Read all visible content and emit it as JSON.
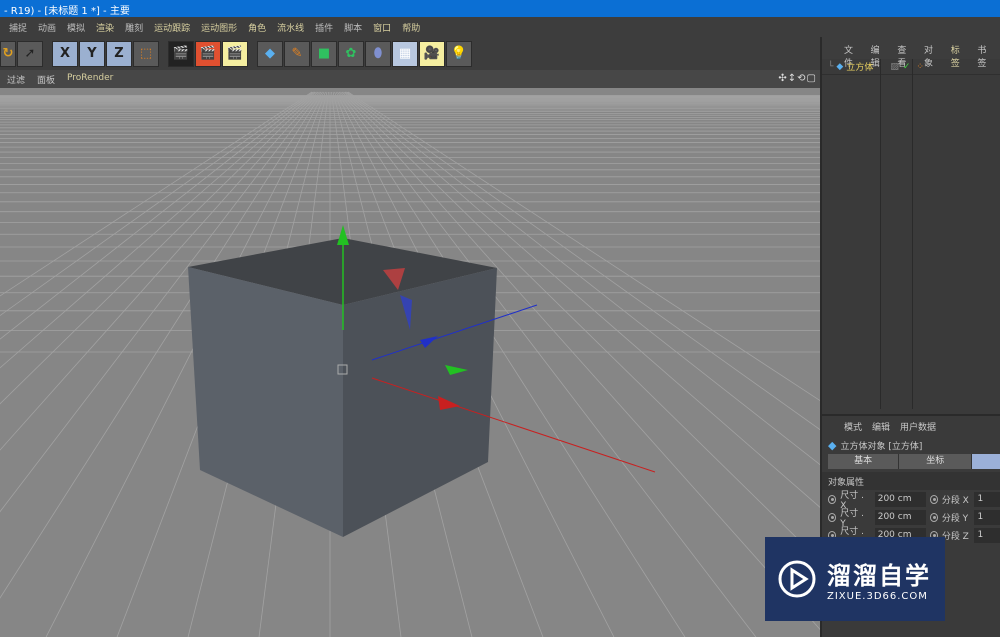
{
  "title": "- R19) - [未标题 1 *] - 主要",
  "menu": [
    "捕捉",
    "动画",
    "模拟",
    "渲染",
    "雕刻",
    "运动跟踪",
    "运动图形",
    "角色",
    "流水线",
    "插件",
    "脚本",
    "窗口",
    "帮助"
  ],
  "toolbar": {
    "x": "X",
    "y": "Y",
    "z": "Z"
  },
  "viewport_menu": [
    "过滤",
    "面板",
    "ProRender"
  ],
  "viewport_icons": "✣↕⟲▢",
  "object_manager": {
    "menu": [
      "文件",
      "编辑",
      "查看",
      "对象",
      "标签",
      "书签"
    ],
    "object_name": "立方体"
  },
  "attributes": {
    "menu": [
      "模式",
      "编辑",
      "用户数据"
    ],
    "object_title": "立方体对象 [立方体]",
    "tabs": [
      "基本",
      "坐标"
    ],
    "section": "对象属性",
    "rows": [
      {
        "label": "尺寸 . X",
        "value": "200 cm",
        "seg_label": "分段 X",
        "seg_value": "1"
      },
      {
        "label": "尺寸 . Y",
        "value": "200 cm",
        "seg_label": "分段 Y",
        "seg_value": "1"
      },
      {
        "label": "尺寸 . Z",
        "value": "200 cm",
        "seg_label": "分段 Z",
        "seg_value": "1"
      }
    ]
  },
  "watermark": {
    "name": "溜溜自学",
    "url": "ZIXUE.3D66.COM"
  },
  "colors": {
    "title_bar": "#0b6fd4",
    "axis_x": "#d02020",
    "axis_y": "#20c020",
    "axis_z": "#2030d0"
  }
}
